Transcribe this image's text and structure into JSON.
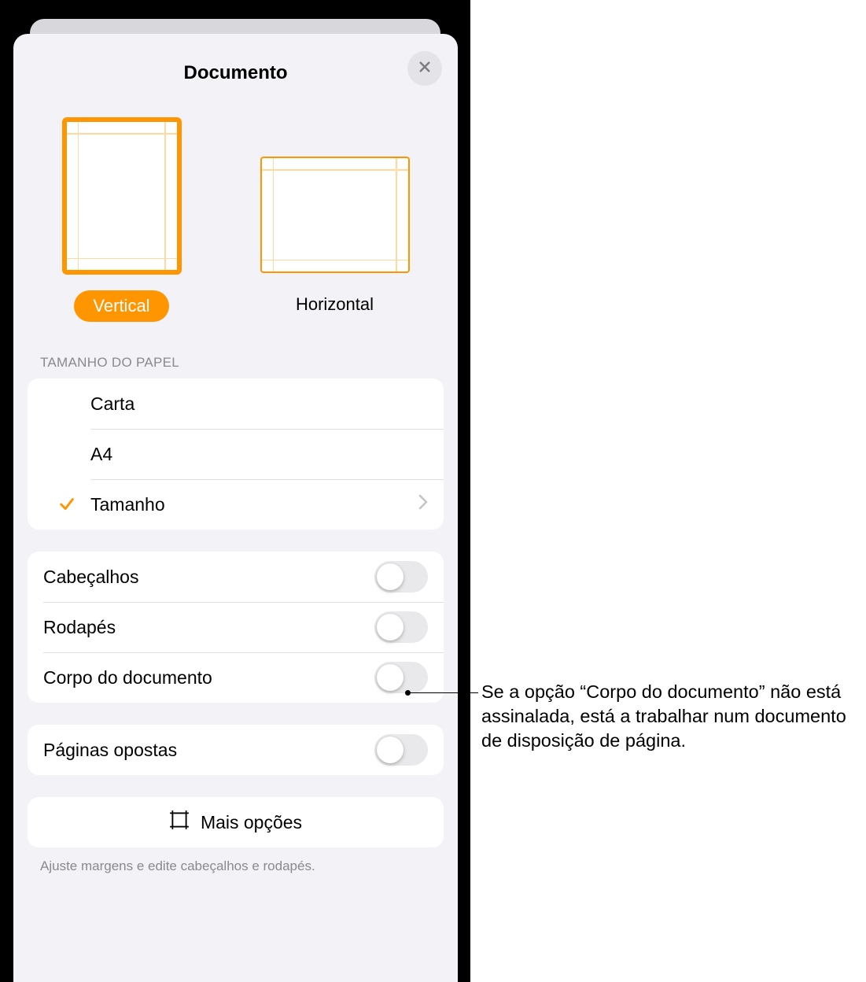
{
  "header": {
    "title": "Documento"
  },
  "orientation": {
    "vertical_label": "Vertical",
    "horizontal_label": "Horizontal",
    "selected": "vertical"
  },
  "paper_size": {
    "section_title": "Tamanho do Papel",
    "options": {
      "carta": "Carta",
      "a4": "A4",
      "tamanho": "Tamanho"
    },
    "selected": "tamanho"
  },
  "toggles": {
    "headers": {
      "label": "Cabeçalhos",
      "on": false
    },
    "footers": {
      "label": "Rodapés",
      "on": false
    },
    "body": {
      "label": "Corpo do documento",
      "on": false
    },
    "facing": {
      "label": "Páginas opostas",
      "on": false
    }
  },
  "more_options": {
    "label": "Mais opções"
  },
  "footer_note": "Ajuste margens e edite cabeçalhos e rodapés.",
  "callout": "Se a opção “Corpo do documento” não está assinalada, está a trabalhar num documento de disposição de página."
}
